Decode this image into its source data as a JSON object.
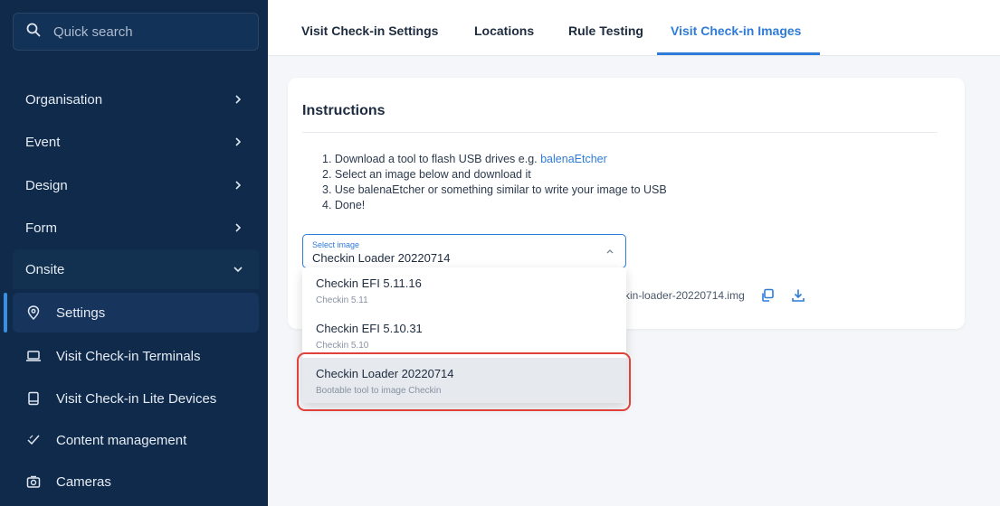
{
  "sidebar": {
    "search_placeholder": "Quick search",
    "items": [
      {
        "label": "Organisation"
      },
      {
        "label": "Event"
      },
      {
        "label": "Design"
      },
      {
        "label": "Form"
      },
      {
        "label": "Onsite"
      }
    ],
    "sub_items": [
      {
        "label": "Settings",
        "icon": "location-pin-icon"
      },
      {
        "label": "Visit Check-in Terminals",
        "icon": "laptop-icon"
      },
      {
        "label": "Visit Check-in Lite Devices",
        "icon": "tablet-icon"
      },
      {
        "label": "Content management",
        "icon": "check-icon"
      },
      {
        "label": "Cameras",
        "icon": "camera-icon"
      }
    ]
  },
  "tabs": [
    {
      "label": "Visit Check-in Settings"
    },
    {
      "label": "Locations"
    },
    {
      "label": "Rule Testing"
    },
    {
      "label": "Visit Check-in Images",
      "active": true
    }
  ],
  "card": {
    "title": "Instructions",
    "step1_prefix": "1. Download a tool to flash USB drives e.g. ",
    "step1_link": "balenaEtcher",
    "step2": "2. Select an image below and download it",
    "step3": "3. Use balenaEtcher or something similar to write your image to USB",
    "step4": "4. Done!",
    "select_label": "Select image",
    "select_value": "Checkin Loader 20220714",
    "file_name": "kin-loader-20220714.img"
  },
  "dropdown": {
    "options": [
      {
        "title": "Checkin EFI 5.11.16",
        "subtitle": "Checkin 5.11"
      },
      {
        "title": "Checkin EFI 5.10.31",
        "subtitle": "Checkin 5.10"
      },
      {
        "title": "Checkin Loader 20220714",
        "subtitle": "Bootable tool to image Checkin",
        "selected": true
      }
    ]
  },
  "colors": {
    "sidebar_bg": "#0f2a4a",
    "accent": "#2f7bd8",
    "highlight": "#e0413a"
  }
}
